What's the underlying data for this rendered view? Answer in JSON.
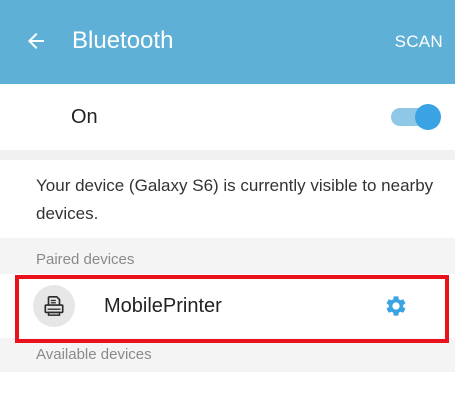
{
  "header": {
    "title": "Bluetooth",
    "scan_label": "SCAN",
    "back_icon": "arrow-back-icon",
    "color": "#5fb0d6"
  },
  "bluetooth_switch": {
    "label": "On",
    "enabled": true,
    "accent_color": "#3aa3e3"
  },
  "visibility_message": "Your device (Galaxy S6) is currently visible to nearby devices.",
  "paired_section": {
    "header": "Paired devices",
    "devices": [
      {
        "name": "MobilePrinter",
        "icon": "printer-icon",
        "settings_icon": "gear-icon",
        "highlighted": true,
        "highlight_color": "#e8111c"
      }
    ]
  },
  "available_section": {
    "header": "Available devices"
  }
}
